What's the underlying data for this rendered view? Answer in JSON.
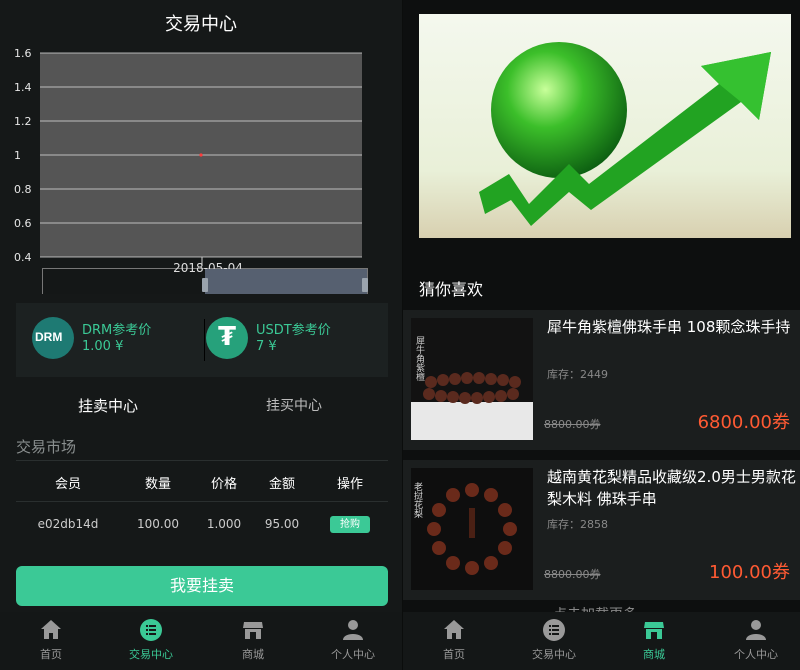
{
  "left": {
    "title": "交易中心",
    "chart_data": {
      "type": "scatter",
      "x": [
        "2018-05-04"
      ],
      "values": [
        1
      ],
      "ylim": [
        0.4,
        1.6
      ],
      "y_ticks": [
        "1.6",
        "1.4",
        "1.2",
        "1",
        "0.8",
        "0.6",
        "0.4"
      ],
      "range_label": "2018-05-04",
      "grid": true,
      "point_color": "#ff3b3b"
    },
    "prices": [
      {
        "logo_text": "DRM",
        "name": "DRM参考价",
        "value": "1.00 ¥"
      },
      {
        "logo_text": "₮",
        "name": "USDT参考价",
        "value": "7 ¥"
      }
    ],
    "tabs": [
      "挂卖中心",
      "挂买中心"
    ],
    "section_title": "交易市场",
    "table": {
      "headers": [
        "会员",
        "数量",
        "价格",
        "金额",
        "操作"
      ],
      "rows": [
        {
          "member": "e02db14d",
          "qty": "100.00",
          "price": "1.000",
          "amount": "95.00",
          "action": "抢购"
        }
      ]
    },
    "main_button": "我要挂卖",
    "nav": [
      "首页",
      "交易中心",
      "商城",
      "个人中心"
    ]
  },
  "right": {
    "guess_title": "猜你喜欢",
    "products": [
      {
        "name": "犀牛角紫檀佛珠手串 108颗念珠手持",
        "stock": "库存：2449",
        "old_price": "8800.00券",
        "price": "6800.00券",
        "img_text": "犀牛角紫檀"
      },
      {
        "name": "越南黄花梨精品收藏级2.0男士男款花梨木料 佛珠手串",
        "stock": "库存：2858",
        "old_price": "8800.00券",
        "price": "100.00券",
        "img_text": "老挝花梨"
      }
    ],
    "load_more": "点击加载更多",
    "nav": [
      "首页",
      "交易中心",
      "商城",
      "个人中心"
    ]
  },
  "colors": {
    "accent": "#3bc996",
    "price": "#ff5a33"
  }
}
